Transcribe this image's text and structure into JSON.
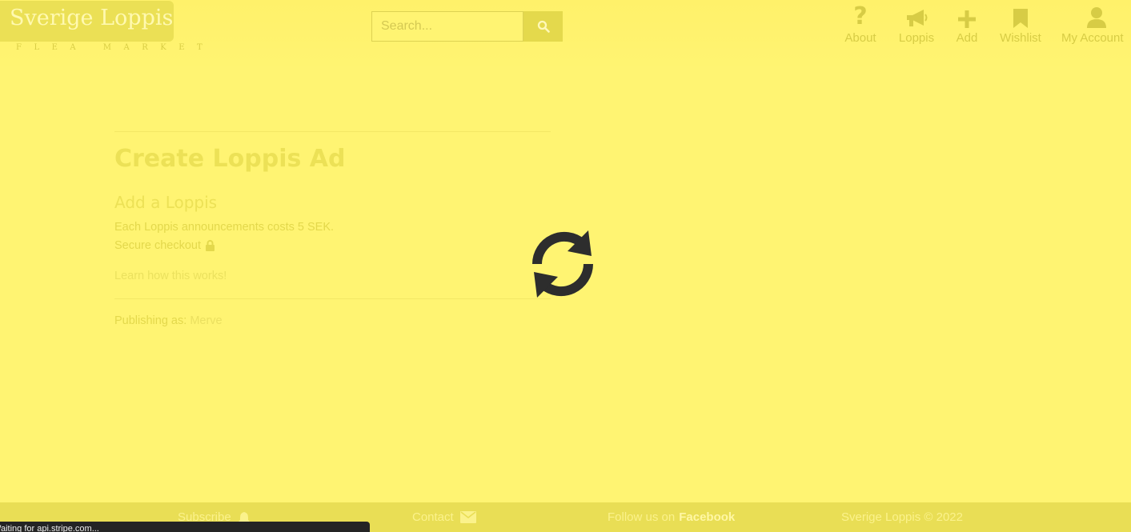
{
  "header": {
    "logo_text": "Sverige Loppis",
    "logo_subtitle": "FLEA MARKET",
    "search": {
      "placeholder": "Search..."
    },
    "nav": [
      {
        "label": "About",
        "icon": "question-icon"
      },
      {
        "label": "Loppis",
        "icon": "megaphone-icon"
      },
      {
        "label": "Add",
        "icon": "plus-icon"
      },
      {
        "label": "Wishlist",
        "icon": "bookmark-icon"
      },
      {
        "label": "My Account",
        "icon": "user-icon"
      }
    ]
  },
  "main": {
    "title": "Create Loppis Ad",
    "subtitle": "Add a Loppis",
    "cost_text": "Each Loppis announcements costs 5 SEK.",
    "secure_text": "Secure checkout",
    "learn_link": "Learn how this works!",
    "publishing_label": "Publishing as:",
    "publishing_user": "Merve"
  },
  "overlay": {
    "icon": "refresh-spinner-icon"
  },
  "footer": {
    "subscribe": "Subscribe",
    "contact": "Contact",
    "follow_label": "Follow us on",
    "follow_link": "Facebook",
    "copyright": "Sverige Loppis © 2022"
  },
  "browser_status": "Waiting for api.stripe.com..."
}
